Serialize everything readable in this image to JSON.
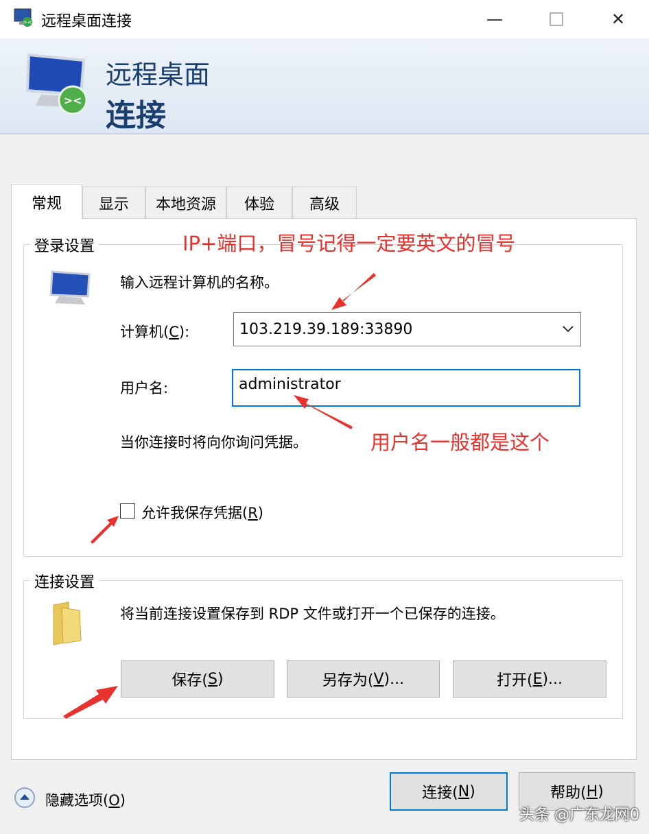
{
  "window": {
    "title": "远程桌面连接",
    "minimize_icon": "minimize-icon",
    "maximize_icon": "maximize-icon",
    "close_icon": "close-icon"
  },
  "banner": {
    "line1": "远程桌面",
    "line2": "连接"
  },
  "tabs": [
    {
      "label": "常规",
      "active": true
    },
    {
      "label": "显示"
    },
    {
      "label": "本地资源"
    },
    {
      "label": "体验"
    },
    {
      "label": "高级"
    }
  ],
  "logon": {
    "group_label": "登录设置",
    "prompt": "输入远程计算机的名称。",
    "computer_label_prefix": "计算机(",
    "computer_label_key": "C",
    "computer_label_suffix": "):",
    "computer_value": "103.219.39.189:33890",
    "username_label": "用户名:",
    "username_value": "administrator",
    "credentials_note": "当你连接时将向你询问凭据。",
    "save_credentials_prefix": "允许我保存凭据(",
    "save_credentials_key": "R",
    "save_credentials_suffix": ")",
    "save_credentials_checked": false
  },
  "connection": {
    "group_label": "连接设置",
    "description": "将当前连接设置保存到 RDP 文件或打开一个已保存的连接。",
    "save_prefix": "保存(",
    "save_key": "S",
    "save_suffix": ")",
    "save_as_prefix": "另存为(",
    "save_as_key": "V",
    "save_as_suffix": ")...",
    "open_prefix": "打开(",
    "open_key": "E",
    "open_suffix": ")..."
  },
  "footer": {
    "hide_options_prefix": "隐藏选项(",
    "hide_options_key": "O",
    "hide_options_suffix": ")",
    "connect_prefix": "连接(",
    "connect_key": "N",
    "connect_suffix": ")",
    "help_prefix": "帮助(",
    "help_key": "H",
    "help_suffix": ")"
  },
  "annotations": {
    "ip_note": "IP+端口，冒号记得一定要英文的冒号",
    "user_note": "用户名一般都是这个",
    "color": "#e8322e"
  },
  "watermark": "头条 @广东龙网0"
}
